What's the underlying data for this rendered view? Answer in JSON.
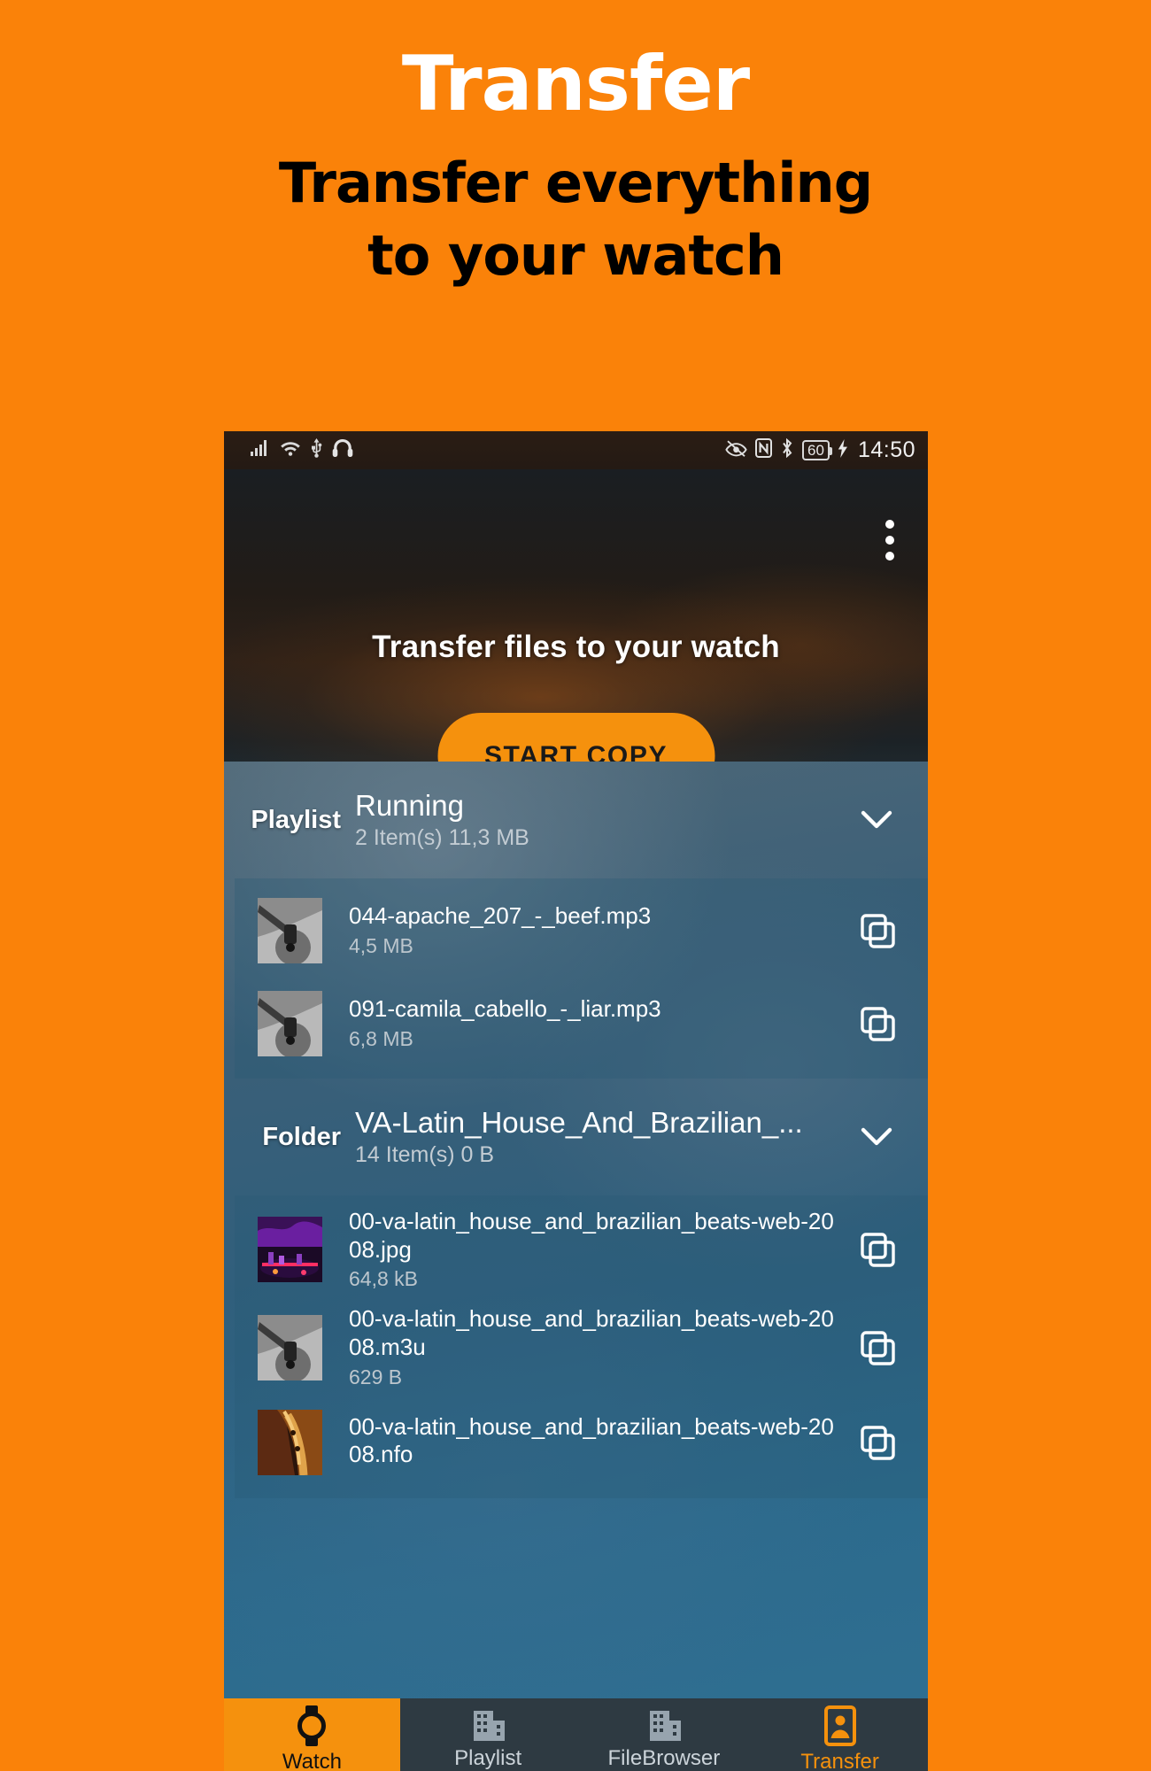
{
  "promo": {
    "title": "Transfer",
    "subtitle_line1": "Transfer everything",
    "subtitle_line2": "to your watch"
  },
  "colors": {
    "brand_orange": "#FA8209",
    "button_orange": "#F5910D",
    "list_blue": "#2E5F7D",
    "nav_bar": "#2E3A42"
  },
  "statusbar": {
    "icons_left": [
      "signal-icon",
      "wifi-icon",
      "usb-icon",
      "headphones-icon"
    ],
    "icons_right": [
      "eye-comfort-icon",
      "nfc-icon",
      "bluetooth-icon"
    ],
    "battery_level": "60",
    "charging": "charging-bolt-icon",
    "time": "14:50"
  },
  "hero": {
    "menu_icon": "kebab-menu-icon",
    "title": "Transfer files to your watch",
    "start_button": "START COPY"
  },
  "sections": [
    {
      "kind": "Playlist",
      "name": "Running",
      "meta": "2 Item(s) 11,3 MB",
      "expand_icon": "chevron-down-icon",
      "items": [
        {
          "thumb": "turntable-thumb",
          "name": "044-apache_207_-_beef.mp3",
          "size": "4,5 MB",
          "action_icon": "copy-icon"
        },
        {
          "thumb": "turntable-thumb",
          "name": "091-camila_cabello_-_liar.mp3",
          "size": "6,8 MB",
          "action_icon": "copy-icon"
        }
      ]
    },
    {
      "kind": "Folder",
      "name": "VA-Latin_House_And_Brazilian_...",
      "meta": "14 Item(s) 0 B",
      "expand_icon": "chevron-down-icon",
      "items": [
        {
          "thumb": "dj-booth-thumb",
          "name": "00-va-latin_house_and_brazilian_beats-web-2008.jpg",
          "size": "64,8 kB",
          "action_icon": "copy-icon"
        },
        {
          "thumb": "turntable-thumb",
          "name": "00-va-latin_house_and_brazilian_beats-web-2008.m3u",
          "size": "629 B",
          "action_icon": "copy-icon"
        },
        {
          "thumb": "saxophone-thumb",
          "name": "00-va-latin_house_and_brazilian_beats-web-2008.nfo",
          "size": "",
          "action_icon": "copy-icon"
        }
      ]
    }
  ],
  "bottomnav": {
    "tabs": [
      {
        "label": "Watch",
        "icon": "watch-icon",
        "state": "active-watch"
      },
      {
        "label": "Playlist",
        "icon": "building-icon",
        "state": "normal"
      },
      {
        "label": "FileBrowser",
        "icon": "building-icon",
        "state": "normal"
      },
      {
        "label": "Transfer",
        "icon": "contact-card-icon",
        "state": "accent"
      }
    ]
  }
}
